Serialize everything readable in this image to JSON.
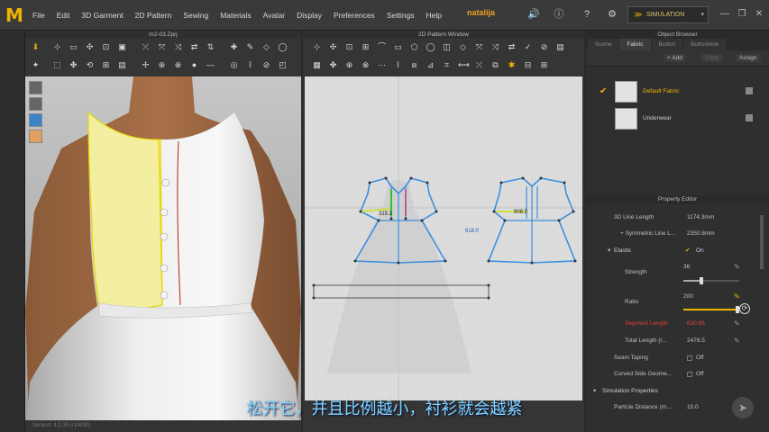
{
  "app": {
    "logo": "M",
    "user": "natalija",
    "simulation_label": "SIMULATION"
  },
  "menu": [
    "File",
    "Edit",
    "3D Garment",
    "2D Pattern",
    "Sewing",
    "Materials",
    "Avatar",
    "Display",
    "Preferences",
    "Settings",
    "Help"
  ],
  "window3d": {
    "title": "m2-03.Zprj",
    "status": "Version: 4.2.35  (r14630)"
  },
  "window2d": {
    "title": "2D Pattern Window"
  },
  "pattern_measures": {
    "left": "315.3",
    "middle": "618.0",
    "right": "908.5"
  },
  "object_browser": {
    "title": "Object Browser",
    "tabs": [
      "Scene",
      "Fabric",
      "Button",
      "Buttonhole"
    ],
    "active_tab": "Fabric",
    "add_label": "+ Add",
    "copy_label": "Copy",
    "assign_label": "Assign",
    "fabrics": [
      {
        "name": "Default Fabric",
        "selected": true
      },
      {
        "name": "Underwear",
        "selected": false
      }
    ]
  },
  "property_editor": {
    "title": "Property Editor",
    "rows": {
      "line_length": {
        "label": "3D Line Length",
        "value": "1174.3mm"
      },
      "sym_line": {
        "label": "+ Symmetric Line L...",
        "value": "2350.8mm"
      },
      "elastic": {
        "label": "Elastic",
        "value": "On"
      },
      "strength": {
        "label": "Strength",
        "value": "36",
        "level": 0.36
      },
      "ratio": {
        "label": "Ratio",
        "value": "200",
        "level": 1.0
      },
      "segment_length": {
        "label": "Segment Length",
        "value": "630.65"
      },
      "total_length": {
        "label": "Total Length (r...",
        "value": "2478.5"
      },
      "seam_taping": {
        "label": "Seam Taping",
        "value": "Off"
      },
      "curved_side": {
        "label": "Curved Side Geome...",
        "value": "Off"
      },
      "sim_props": {
        "label": "Simulation Properties"
      },
      "particle_distance": {
        "label": "Particle Distance (m...",
        "value": "10.0"
      }
    }
  },
  "subtitle": "松开它，并且比例越小，衬衫就会越紧"
}
